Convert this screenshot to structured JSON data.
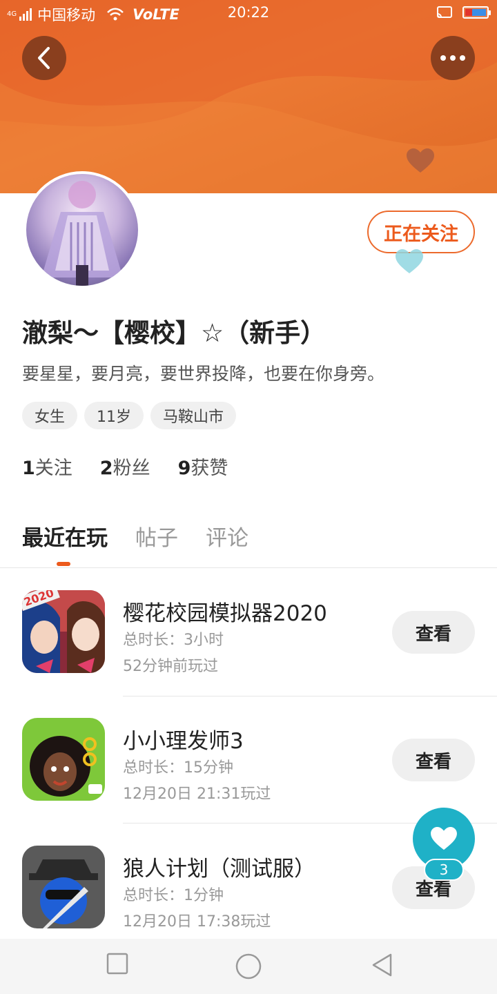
{
  "status_bar": {
    "network": "4G",
    "carrier": "中国移动",
    "volte": "VoLTE",
    "time": "20:22"
  },
  "header": {
    "back_icon": "chevron-left-icon",
    "more_icon": "more-dots-icon"
  },
  "profile": {
    "follow_button": "正在关注",
    "name": "澈梨～【樱校】☆（新手）",
    "bio": "要星星，要月亮，要世界投降，也要在你身旁。",
    "tags": [
      "女生",
      "11岁",
      "马鞍山市"
    ],
    "stats": [
      {
        "count": "1",
        "label": "关注"
      },
      {
        "count": "2",
        "label": "粉丝"
      },
      {
        "count": "9",
        "label": "获赞"
      }
    ]
  },
  "tabs": [
    {
      "label": "最近在玩",
      "active": true
    },
    {
      "label": "帖子",
      "active": false
    },
    {
      "label": "评论",
      "active": false
    }
  ],
  "games": [
    {
      "title": "樱花校园模拟器2020",
      "duration": "总时长：3小时",
      "played": "52分钟前玩过",
      "button": "查看",
      "badge": "2020"
    },
    {
      "title": "小小理发师3",
      "duration": "总时长：15分钟",
      "played": "12月20日 21:31玩过",
      "button": "查看"
    },
    {
      "title": "狼人计划（测试服）",
      "duration": "总时长：1分钟",
      "played": "12月20日 17:38玩过",
      "button": "查看"
    }
  ],
  "fab": {
    "icon": "heart-icon",
    "count": "3"
  },
  "colors": {
    "accent": "#ec5a1c",
    "banner": "#e8692a",
    "fab": "#1fb1c7"
  }
}
